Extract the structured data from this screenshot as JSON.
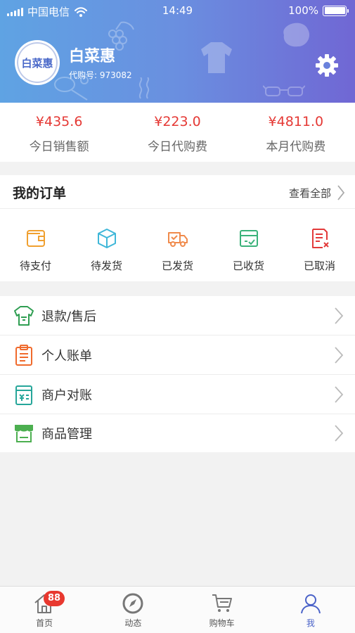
{
  "status_bar": {
    "carrier": "中国电信",
    "time": "14:49",
    "battery": "100%"
  },
  "profile": {
    "avatar_text": "白菜惠",
    "name": "白菜惠",
    "id_label": "代购号:",
    "id_value": "973082"
  },
  "stats": [
    {
      "value": "¥435.6",
      "label": "今日销售额"
    },
    {
      "value": "¥223.0",
      "label": "今日代购费"
    },
    {
      "value": "¥4811.0",
      "label": "本月代购费"
    }
  ],
  "orders": {
    "title": "我的订单",
    "view_all": "查看全部",
    "items": [
      {
        "label": "待支付",
        "icon": "wallet-icon",
        "color": "#f0a030"
      },
      {
        "label": "待发货",
        "icon": "box-icon",
        "color": "#3fb7d8"
      },
      {
        "label": "已发货",
        "icon": "truck-icon",
        "color": "#f08a4b"
      },
      {
        "label": "已收货",
        "icon": "inbox-check-icon",
        "color": "#3bb27a"
      },
      {
        "label": "已取消",
        "icon": "cancel-document-icon",
        "color": "#e33a3a"
      }
    ]
  },
  "menu": [
    {
      "label": "退款/售后",
      "icon": "refund-shirt-icon",
      "color": "#2f9e52"
    },
    {
      "label": "个人账单",
      "icon": "clipboard-icon",
      "color": "#f06a2c"
    },
    {
      "label": "商户对账",
      "icon": "ledger-icon",
      "color": "#26a69a"
    },
    {
      "label": "商品管理",
      "icon": "store-icon",
      "color": "#4caf50"
    }
  ],
  "tabbar": {
    "items": [
      {
        "label": "首页",
        "icon": "home-icon",
        "badge": "88"
      },
      {
        "label": "动态",
        "icon": "compass-icon"
      },
      {
        "label": "购物车",
        "icon": "cart-icon"
      },
      {
        "label": "我",
        "icon": "person-icon"
      }
    ],
    "active_color": "#4a62c8"
  }
}
